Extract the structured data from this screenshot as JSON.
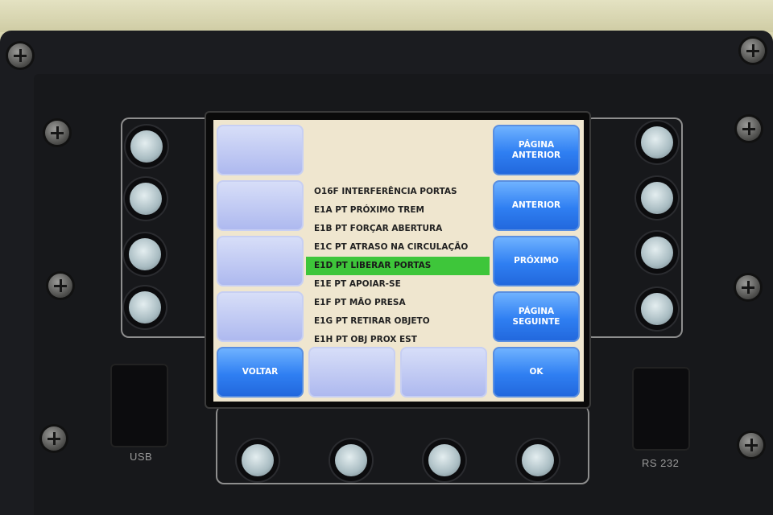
{
  "device": {
    "port_labels": {
      "usb": "USB",
      "rs232": "RS 232"
    }
  },
  "screen": {
    "left_keys": [
      {
        "label": "",
        "state": "blank"
      },
      {
        "label": "",
        "state": "blank"
      },
      {
        "label": "",
        "state": "blank"
      },
      {
        "label": "",
        "state": "blank"
      }
    ],
    "right_keys": [
      {
        "label": "PÁGINA\nANTERIOR",
        "state": "active"
      },
      {
        "label": "ANTERIOR",
        "state": "active"
      },
      {
        "label": "PRÓXIMO",
        "state": "active"
      },
      {
        "label": "PÁGINA\nSEGUINTE",
        "state": "active"
      }
    ],
    "bottom_keys": [
      {
        "label": "VOLTAR",
        "state": "active"
      },
      {
        "label": "",
        "state": "blank"
      },
      {
        "label": "",
        "state": "blank"
      },
      {
        "label": "OK",
        "state": "active"
      }
    ],
    "messages": [
      "O16F INTERFERÊNCIA PORTAS",
      "E1A PT PRÓXIMO TREM",
      "E1B PT FORÇAR ABERTURA",
      "E1C PT ATRASO NA CIRCULAÇÃO",
      "E1D PT LIBERAR PORTAS",
      "E1E PT APOIAR-SE",
      "E1F PT MÃO PRESA",
      "E1G PT RETIRAR OBJETO",
      "E1H PT OBJ PROX EST"
    ],
    "selected_index": 4
  },
  "colors": {
    "screen_bg": "#efe6cf",
    "active_key": "#2f7ff2",
    "blank_key": "#b8c2f2",
    "selection": "#3ec63a"
  }
}
